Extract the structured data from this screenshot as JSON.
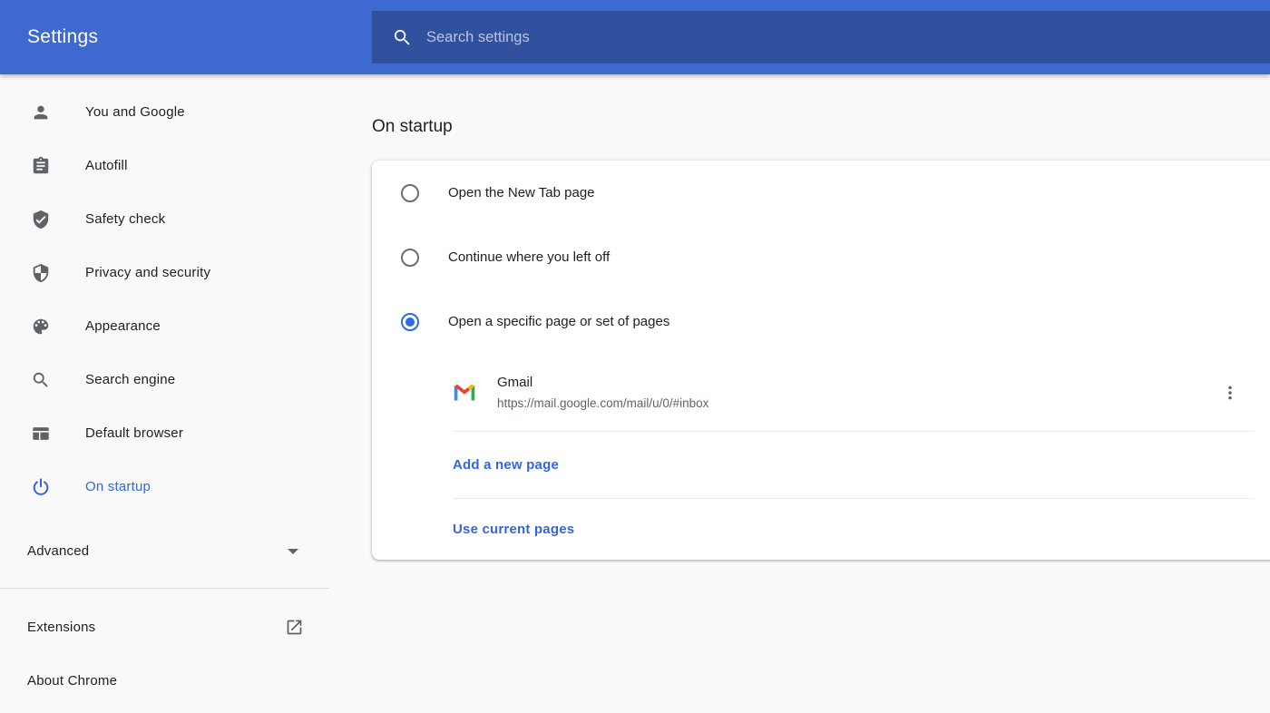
{
  "header": {
    "title": "Settings",
    "search_placeholder": "Search settings"
  },
  "sidebar": {
    "items": [
      {
        "label": "You and Google",
        "icon": "person-icon",
        "selected": false
      },
      {
        "label": "Autofill",
        "icon": "clipboard-icon",
        "selected": false
      },
      {
        "label": "Safety check",
        "icon": "shield-check-icon",
        "selected": false
      },
      {
        "label": "Privacy and security",
        "icon": "security-shield-icon",
        "selected": false
      },
      {
        "label": "Appearance",
        "icon": "palette-icon",
        "selected": false
      },
      {
        "label": "Search engine",
        "icon": "search-icon",
        "selected": false
      },
      {
        "label": "Default browser",
        "icon": "browser-window-icon",
        "selected": false
      },
      {
        "label": "On startup",
        "icon": "power-icon",
        "selected": true
      }
    ],
    "advanced_label": "Advanced",
    "extensions_label": "Extensions",
    "about_label": "About Chrome"
  },
  "main": {
    "section_title": "On startup",
    "options": [
      {
        "label": "Open the New Tab page",
        "selected": false
      },
      {
        "label": "Continue where you left off",
        "selected": false
      },
      {
        "label": "Open a specific page or set of pages",
        "selected": true
      }
    ],
    "page_entry": {
      "title": "Gmail",
      "url": "https://mail.google.com/mail/u/0/#inbox"
    },
    "add_page_label": "Add a new page",
    "use_current_label": "Use current pages"
  },
  "colors": {
    "header_bg": "#3e69d1",
    "search_field_bg": "#31519e",
    "accent_blue": "#3565d9",
    "radio_selected_blue": "#2d6be2",
    "text_primary": "#202124",
    "text_secondary": "#5f6368",
    "gmail_blue": "#4285f4",
    "gmail_green": "#34a853",
    "gmail_red": "#ea4335",
    "gmail_yellow": "#fbbc04"
  }
}
